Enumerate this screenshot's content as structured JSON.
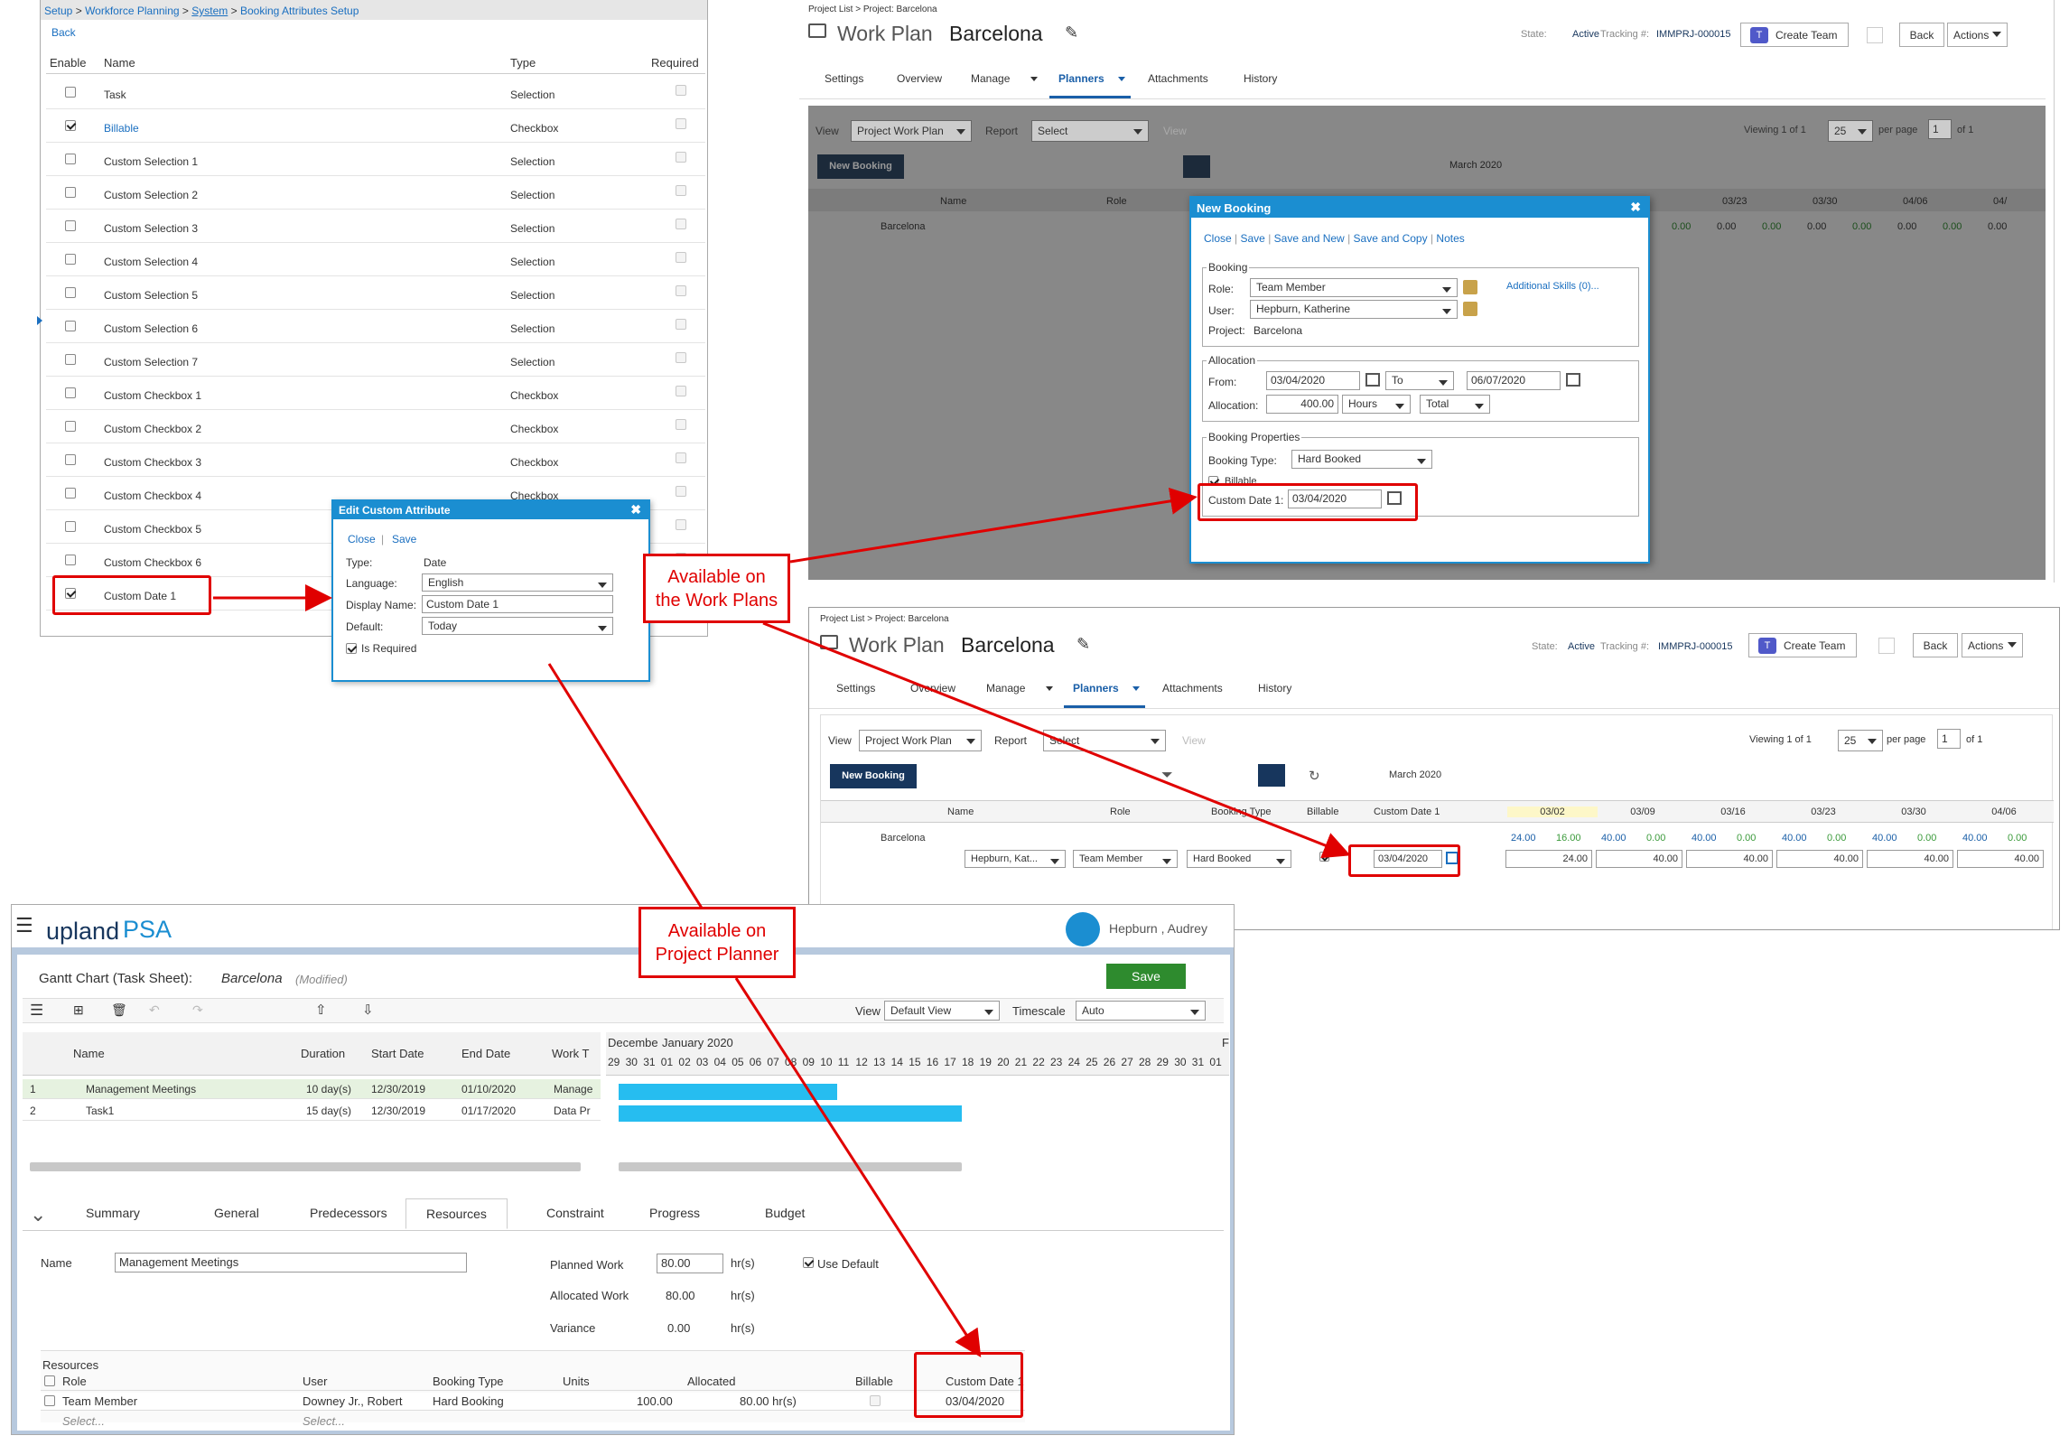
{
  "setup": {
    "breadcrumb": [
      "Setup",
      "Workforce Planning",
      "System",
      "Booking Attributes Setup"
    ],
    "sep": ">",
    "back": "Back",
    "headers": {
      "enable": "Enable",
      "name": "Name",
      "type": "Type",
      "required": "Required"
    },
    "rows": [
      {
        "name": "Task",
        "type": "Selection",
        "enabled": false
      },
      {
        "name": "Billable",
        "type": "Checkbox",
        "enabled": true
      },
      {
        "name": "Custom Selection 1",
        "type": "Selection",
        "enabled": false
      },
      {
        "name": "Custom Selection 2",
        "type": "Selection",
        "enabled": false
      },
      {
        "name": "Custom Selection 3",
        "type": "Selection",
        "enabled": false
      },
      {
        "name": "Custom Selection 4",
        "type": "Selection",
        "enabled": false
      },
      {
        "name": "Custom Selection 5",
        "type": "Selection",
        "enabled": false
      },
      {
        "name": "Custom Selection 6",
        "type": "Selection",
        "enabled": false
      },
      {
        "name": "Custom Selection 7",
        "type": "Selection",
        "enabled": false
      },
      {
        "name": "Custom Checkbox 1",
        "type": "Checkbox",
        "enabled": false
      },
      {
        "name": "Custom Checkbox 2",
        "type": "Checkbox",
        "enabled": false
      },
      {
        "name": "Custom Checkbox 3",
        "type": "Checkbox",
        "enabled": false
      },
      {
        "name": "Custom Checkbox 4",
        "type": "Checkbox",
        "enabled": false
      },
      {
        "name": "Custom Checkbox 5",
        "type": "Checkbox",
        "enabled": false
      },
      {
        "name": "Custom Checkbox 6",
        "type": "Checkbox",
        "enabled": false
      },
      {
        "name": "Custom Date 1",
        "type": "",
        "enabled": true
      }
    ]
  },
  "edit_dialog": {
    "title": "Edit Custom Attribute",
    "close": "Close",
    "sep": "|",
    "save": "Save",
    "type_label": "Type:",
    "type_value": "Date",
    "language_label": "Language:",
    "language_value": "English",
    "display_label": "Display Name:",
    "display_value": "Custom Date 1",
    "default_label": "Default:",
    "default_value": "Today",
    "required_label": "Is Required"
  },
  "workplan": {
    "breadcrumb": "Project List > Project: Barcelona",
    "title_prefix": "Work Plan",
    "title_name": "Barcelona",
    "state_label": "State:",
    "state_value": "Active",
    "tracking_label": "Tracking #:",
    "tracking_value": "IMMPRJ-000015",
    "create_team": "Create Team",
    "back": "Back",
    "actions": "Actions",
    "tabs": [
      "Settings",
      "Overview",
      "Manage",
      "Planners",
      "Attachments",
      "History"
    ],
    "view_label": "View",
    "view_value": "Project Work Plan",
    "report_label": "Report",
    "report_value": "Select",
    "view_btn": "View",
    "viewing": "Viewing 1 of 1",
    "per_page_value": "25",
    "per_page": "per page",
    "page": "1",
    "of": "of 1",
    "new_booking": "New Booking",
    "month": "March 2020",
    "col_name": "Name",
    "col_role": "Role",
    "col_booking_type": "Booking Type",
    "col_billable": "Billable",
    "col_custom_date": "Custom Date 1",
    "weeks": [
      "03/02",
      "03/09",
      "03/16",
      "03/23",
      "03/30",
      "04/06"
    ],
    "top_weeks": [
      "03/23",
      "03/30",
      "04/06",
      "04/"
    ],
    "project_row": "Barcelona",
    "top_row_values": [
      "0.00",
      "0.00",
      "0.00",
      "0.00",
      "0.00",
      "0.00",
      "0.00",
      "0.00"
    ],
    "bottom_row_values": [
      "24.00",
      "16.00",
      "40.00",
      "0.00",
      "40.00",
      "0.00",
      "40.00",
      "0.00",
      "40.00",
      "0.00",
      "40.00",
      "0.00"
    ],
    "booking_row": {
      "user": "Hepburn, Kat...",
      "role": "Team Member",
      "type": "Hard Booked",
      "date": "03/04/2020",
      "values": [
        "24.00",
        "40.00",
        "40.00",
        "40.00",
        "40.00",
        "40.00"
      ]
    }
  },
  "new_booking": {
    "title": "New Booking",
    "links": [
      "Close",
      "Save",
      "Save and New",
      "Save and Copy",
      "Notes"
    ],
    "booking_legend": "Booking",
    "role_label": "Role:",
    "role_value": "Team Member",
    "additional": "Additional Skills (0)...",
    "user_label": "User:",
    "user_value": "Hepburn, Katherine",
    "project_label": "Project:",
    "project_value": "Barcelona",
    "alloc_legend": "Allocation",
    "from_label": "From:",
    "from_value": "03/04/2020",
    "to_value": "To",
    "end_value": "06/07/2020",
    "alloc_label": "Allocation:",
    "alloc_value": "400.00",
    "unit_value": "Hours",
    "total_value": "Total",
    "props_legend": "Booking Properties",
    "btype_label": "Booking Type:",
    "btype_value": "Hard Booked",
    "billable_label": "Billable",
    "cdate_label": "Custom Date 1:",
    "cdate_value": "03/04/2020"
  },
  "psa": {
    "logo_upland": "upland",
    "logo_psa": "PSA",
    "user": "Hepburn , Audrey",
    "title": "Gantt Chart (Task Sheet):",
    "project": "Barcelona",
    "modified": "(Modified)",
    "save": "Save",
    "view_label": "View",
    "view_value": "Default View",
    "timescale_label": "Timescale",
    "timescale_value": "Auto",
    "cols": {
      "name": "Name",
      "duration": "Duration",
      "start": "Start Date",
      "end": "End Date",
      "work": "Work T"
    },
    "rows": [
      {
        "num": "1",
        "name": "Management Meetings",
        "duration": "10 day(s)",
        "start": "12/30/2019",
        "end": "01/10/2020",
        "work": "Manage"
      },
      {
        "num": "2",
        "name": "Task1",
        "duration": "15 day(s)",
        "start": "12/30/2019",
        "end": "01/17/2020",
        "work": "Data Pr"
      }
    ],
    "months": [
      "Decembe",
      "January 2020",
      "F"
    ],
    "days": [
      "29",
      "30",
      "31",
      "01",
      "02",
      "03",
      "04",
      "05",
      "06",
      "07",
      "08",
      "09",
      "10",
      "11",
      "12",
      "13",
      "14",
      "15",
      "16",
      "17",
      "18",
      "19",
      "20",
      "21",
      "22",
      "23",
      "24",
      "25",
      "26",
      "27",
      "28",
      "29",
      "30",
      "31",
      "01"
    ],
    "tabs": [
      "Summary",
      "General",
      "Predecessors",
      "Resources",
      "Constraint",
      "Progress",
      "Budget"
    ],
    "name_label": "Name",
    "name_value": "Management Meetings",
    "planned_label": "Planned Work",
    "planned_value": "80.00",
    "hrs": "hr(s)",
    "allocated_label": "Allocated Work",
    "allocated_value": "80.00",
    "variance_label": "Variance",
    "variance_value": "0.00",
    "use_default": "Use Default",
    "resources_label": "Resources",
    "res_cols": {
      "role": "Role",
      "user": "User",
      "btype": "Booking Type",
      "units": "Units",
      "allocated": "Allocated",
      "billable": "Billable",
      "cdate": "Custom Date 1"
    },
    "res_row": {
      "role": "Team Member",
      "user": "Downey Jr., Robert",
      "btype": "Hard Booking",
      "units": "100.00",
      "allocated": "80.00 hr(s)",
      "cdate": "03/04/2020"
    },
    "select_role": "Select...",
    "select_user": "Select..."
  },
  "callouts": {
    "workplans": "Available on\nthe Work Plans",
    "planner": "Available on\nProject Planner"
  },
  "colors": {
    "accent": "#1a6fc0",
    "dialog": "#1b8ed1",
    "callout": "#e00000",
    "dark_btn": "#17365d",
    "save_green": "#2e8b2e"
  }
}
